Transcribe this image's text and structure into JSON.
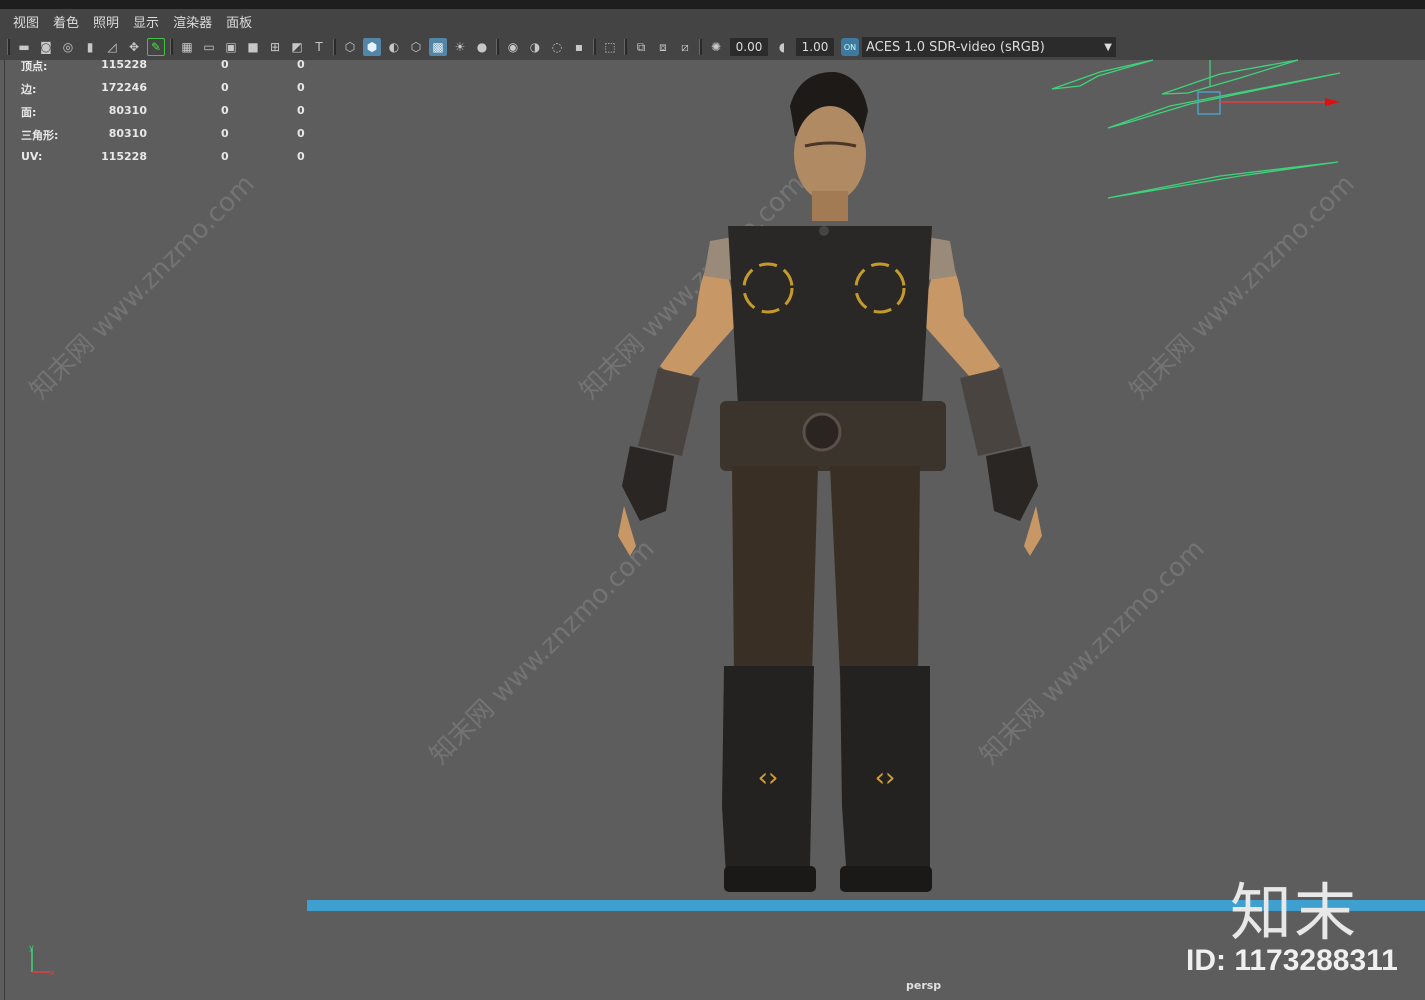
{
  "menu": [
    "视图",
    "着色",
    "照明",
    "显示",
    "渲染器",
    "面板"
  ],
  "toolbar": {
    "exposure_value": "0.00",
    "gamma_value": "1.00",
    "color_management_badge": "ON",
    "color_space": "ACES 1.0 SDR-video (sRGB)"
  },
  "hud": {
    "rows": [
      {
        "label": "顶点:",
        "v1": "115228",
        "v2": "0",
        "v3": "0"
      },
      {
        "label": "边:",
        "v1": "172246",
        "v2": "0",
        "v3": "0"
      },
      {
        "label": "面:",
        "v1": "80310",
        "v2": "0",
        "v3": "0"
      },
      {
        "label": "三角形:",
        "v1": "80310",
        "v2": "0",
        "v3": "0"
      },
      {
        "label": "UV:",
        "v1": "115228",
        "v2": "0",
        "v3": "0"
      }
    ]
  },
  "viewport": {
    "camera_label": "persp",
    "ground_color": "#3fa0d0",
    "background_color": "#5d5d5d"
  },
  "watermark": {
    "brand": "知末",
    "id_text": "ID: 1173288311",
    "diagonal_text": "知末网 www.znzmo.com"
  },
  "axis": {
    "y": "y",
    "x": "x"
  }
}
